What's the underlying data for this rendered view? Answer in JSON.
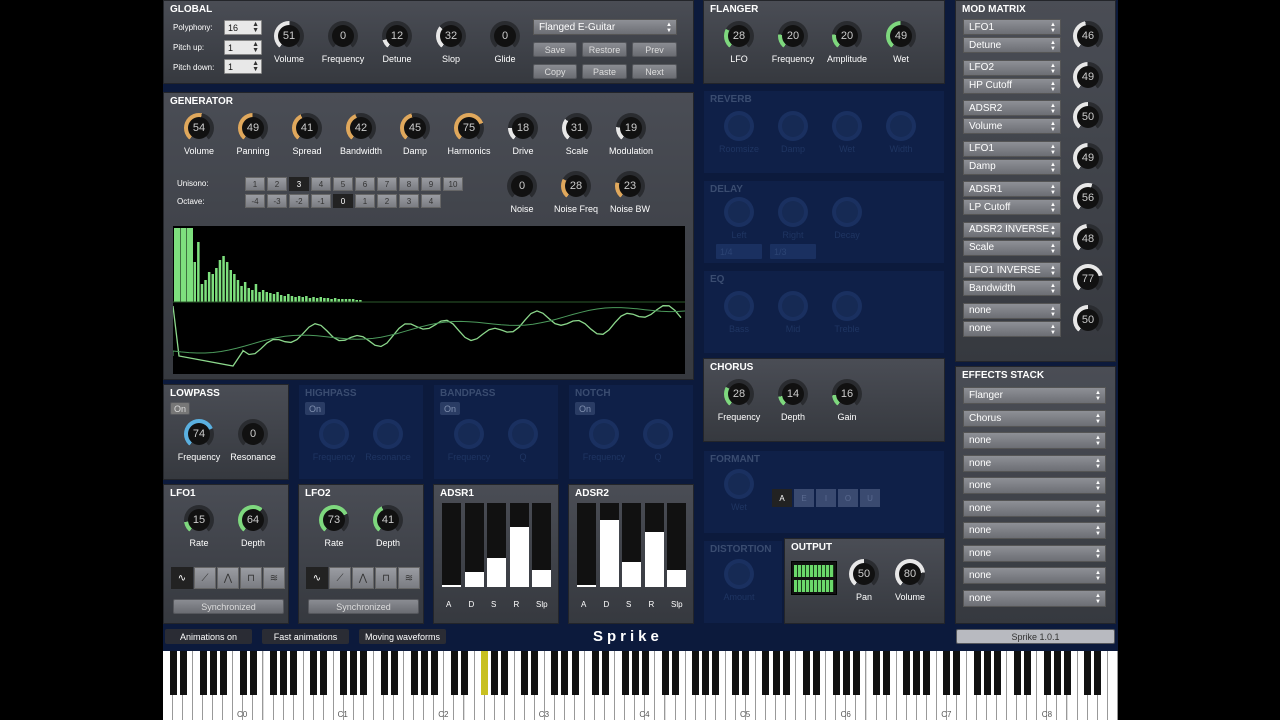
{
  "global": {
    "title": "GLOBAL",
    "polyphony_label": "Polyphony:",
    "polyphony": "16",
    "pitchup_label": "Pitch up:",
    "pitchup": "1",
    "pitchdown_label": "Pitch down:",
    "pitchdown": "1",
    "knobs": [
      {
        "label": "Volume",
        "value": "51"
      },
      {
        "label": "Frequency",
        "value": "0"
      },
      {
        "label": "Detune",
        "value": "12"
      },
      {
        "label": "Slop",
        "value": "32"
      },
      {
        "label": "Glide",
        "value": "0"
      }
    ],
    "preset": "Flanged E-Guitar",
    "save": "Save",
    "restore": "Restore",
    "prev": "Prev",
    "copy": "Copy",
    "paste": "Paste",
    "next": "Next"
  },
  "generator": {
    "title": "GENERATOR",
    "knobs": [
      {
        "label": "Volume",
        "value": "54"
      },
      {
        "label": "Panning",
        "value": "49"
      },
      {
        "label": "Spread",
        "value": "41"
      },
      {
        "label": "Bandwidth",
        "value": "42"
      },
      {
        "label": "Damp",
        "value": "45"
      },
      {
        "label": "Harmonics",
        "value": "75"
      },
      {
        "label": "Drive",
        "value": "18"
      },
      {
        "label": "Scale",
        "value": "31"
      },
      {
        "label": "Modulation",
        "value": "19"
      }
    ],
    "unison_label": "Unisono:",
    "unison": [
      "1",
      "2",
      "3",
      "4",
      "5",
      "6",
      "7",
      "8",
      "9",
      "10"
    ],
    "octave_label": "Octave:",
    "octave": [
      "-4",
      "-3",
      "-2",
      "-1",
      "0",
      "1",
      "2",
      "3",
      "4"
    ],
    "noise": [
      {
        "label": "Noise",
        "value": "0"
      },
      {
        "label": "Noise Freq",
        "value": "28"
      },
      {
        "label": "Noise BW",
        "value": "23"
      }
    ]
  },
  "flanger": {
    "title": "FLANGER",
    "knobs": [
      {
        "label": "LFO",
        "value": "28"
      },
      {
        "label": "Frequency",
        "value": "20"
      },
      {
        "label": "Amplitude",
        "value": "20"
      },
      {
        "label": "Wet",
        "value": "49"
      }
    ]
  },
  "reverb": {
    "title": "REVERB",
    "knobs": [
      "Roomsize",
      "Damp",
      "Wet",
      "Width"
    ]
  },
  "delay": {
    "title": "DELAY",
    "knobs": [
      "Left",
      "Right",
      "Decay"
    ],
    "sel1": "1/4",
    "sel2": "1/3"
  },
  "eq": {
    "title": "EQ",
    "knobs": [
      "Bass",
      "Mid",
      "Treble"
    ]
  },
  "chorus": {
    "title": "CHORUS",
    "knobs": [
      {
        "label": "Frequency",
        "value": "28"
      },
      {
        "label": "Depth",
        "value": "14"
      },
      {
        "label": "Gain",
        "value": "16"
      }
    ]
  },
  "formant": {
    "title": "FORMANT",
    "knob": "Wet",
    "btns": [
      "A",
      "E",
      "I",
      "O",
      "U"
    ]
  },
  "distortion": {
    "title": "DISTORTION",
    "knob": "Amount"
  },
  "output": {
    "title": "OUTPUT",
    "knobs": [
      {
        "label": "Pan",
        "value": "50"
      },
      {
        "label": "Volume",
        "value": "80"
      }
    ]
  },
  "lowpass": {
    "title": "LOWPASS",
    "on": "On",
    "knobs": [
      {
        "label": "Frequency",
        "value": "74"
      },
      {
        "label": "Resonance",
        "value": "0"
      }
    ]
  },
  "highpass": {
    "title": "HIGHPASS",
    "on": "On",
    "knobs": [
      "Frequency",
      "Resonance"
    ]
  },
  "bandpass": {
    "title": "BANDPASS",
    "on": "On",
    "knobs": [
      "Frequency",
      "Q"
    ]
  },
  "notch": {
    "title": "NOTCH",
    "on": "On",
    "knobs": [
      "Frequency",
      "Q"
    ]
  },
  "lfo1": {
    "title": "LFO1",
    "knobs": [
      {
        "label": "Rate",
        "value": "15"
      },
      {
        "label": "Depth",
        "value": "64"
      }
    ],
    "sync": "Synchronized"
  },
  "lfo2": {
    "title": "LFO2",
    "knobs": [
      {
        "label": "Rate",
        "value": "73"
      },
      {
        "label": "Depth",
        "value": "41"
      }
    ],
    "sync": "Synchronized"
  },
  "adsr1": {
    "title": "ADSR1",
    "labels": [
      "A",
      "D",
      "S",
      "R",
      "Slp"
    ],
    "levels": [
      0.02,
      0.18,
      0.34,
      0.72,
      0.2
    ]
  },
  "adsr2": {
    "title": "ADSR2",
    "labels": [
      "A",
      "D",
      "S",
      "R",
      "Slp"
    ],
    "levels": [
      0.02,
      0.8,
      0.3,
      0.65,
      0.2
    ]
  },
  "modmatrix": {
    "title": "MOD MATRIX",
    "rows": [
      {
        "src": "LFO1",
        "dst": "Detune",
        "value": "46"
      },
      {
        "src": "LFO2",
        "dst": "HP Cutoff",
        "value": "49"
      },
      {
        "src": "ADSR2",
        "dst": "Volume",
        "value": "50"
      },
      {
        "src": "LFO1",
        "dst": "Damp",
        "value": "49"
      },
      {
        "src": "ADSR1",
        "dst": "LP Cutoff",
        "value": "56"
      },
      {
        "src": "ADSR2 INVERSE",
        "dst": "Scale",
        "value": "48"
      },
      {
        "src": "LFO1 INVERSE",
        "dst": "Bandwidth",
        "value": "77"
      },
      {
        "src": "none",
        "dst": "none",
        "value": "50"
      }
    ]
  },
  "effects": {
    "title": "EFFECTS STACK",
    "items": [
      "Flanger",
      "Chorus",
      "none",
      "none",
      "none",
      "none",
      "none",
      "none",
      "none",
      "none"
    ]
  },
  "bottom": {
    "anim": "Animations on",
    "fast": "Fast animations",
    "moving": "Moving waveforms",
    "brand": "Sprike",
    "version": "Sprike 1.0.1"
  },
  "keys": {
    "octaves": [
      "C0",
      "C1",
      "C2",
      "C3",
      "C4",
      "C5",
      "C6",
      "C7",
      "C8"
    ]
  }
}
